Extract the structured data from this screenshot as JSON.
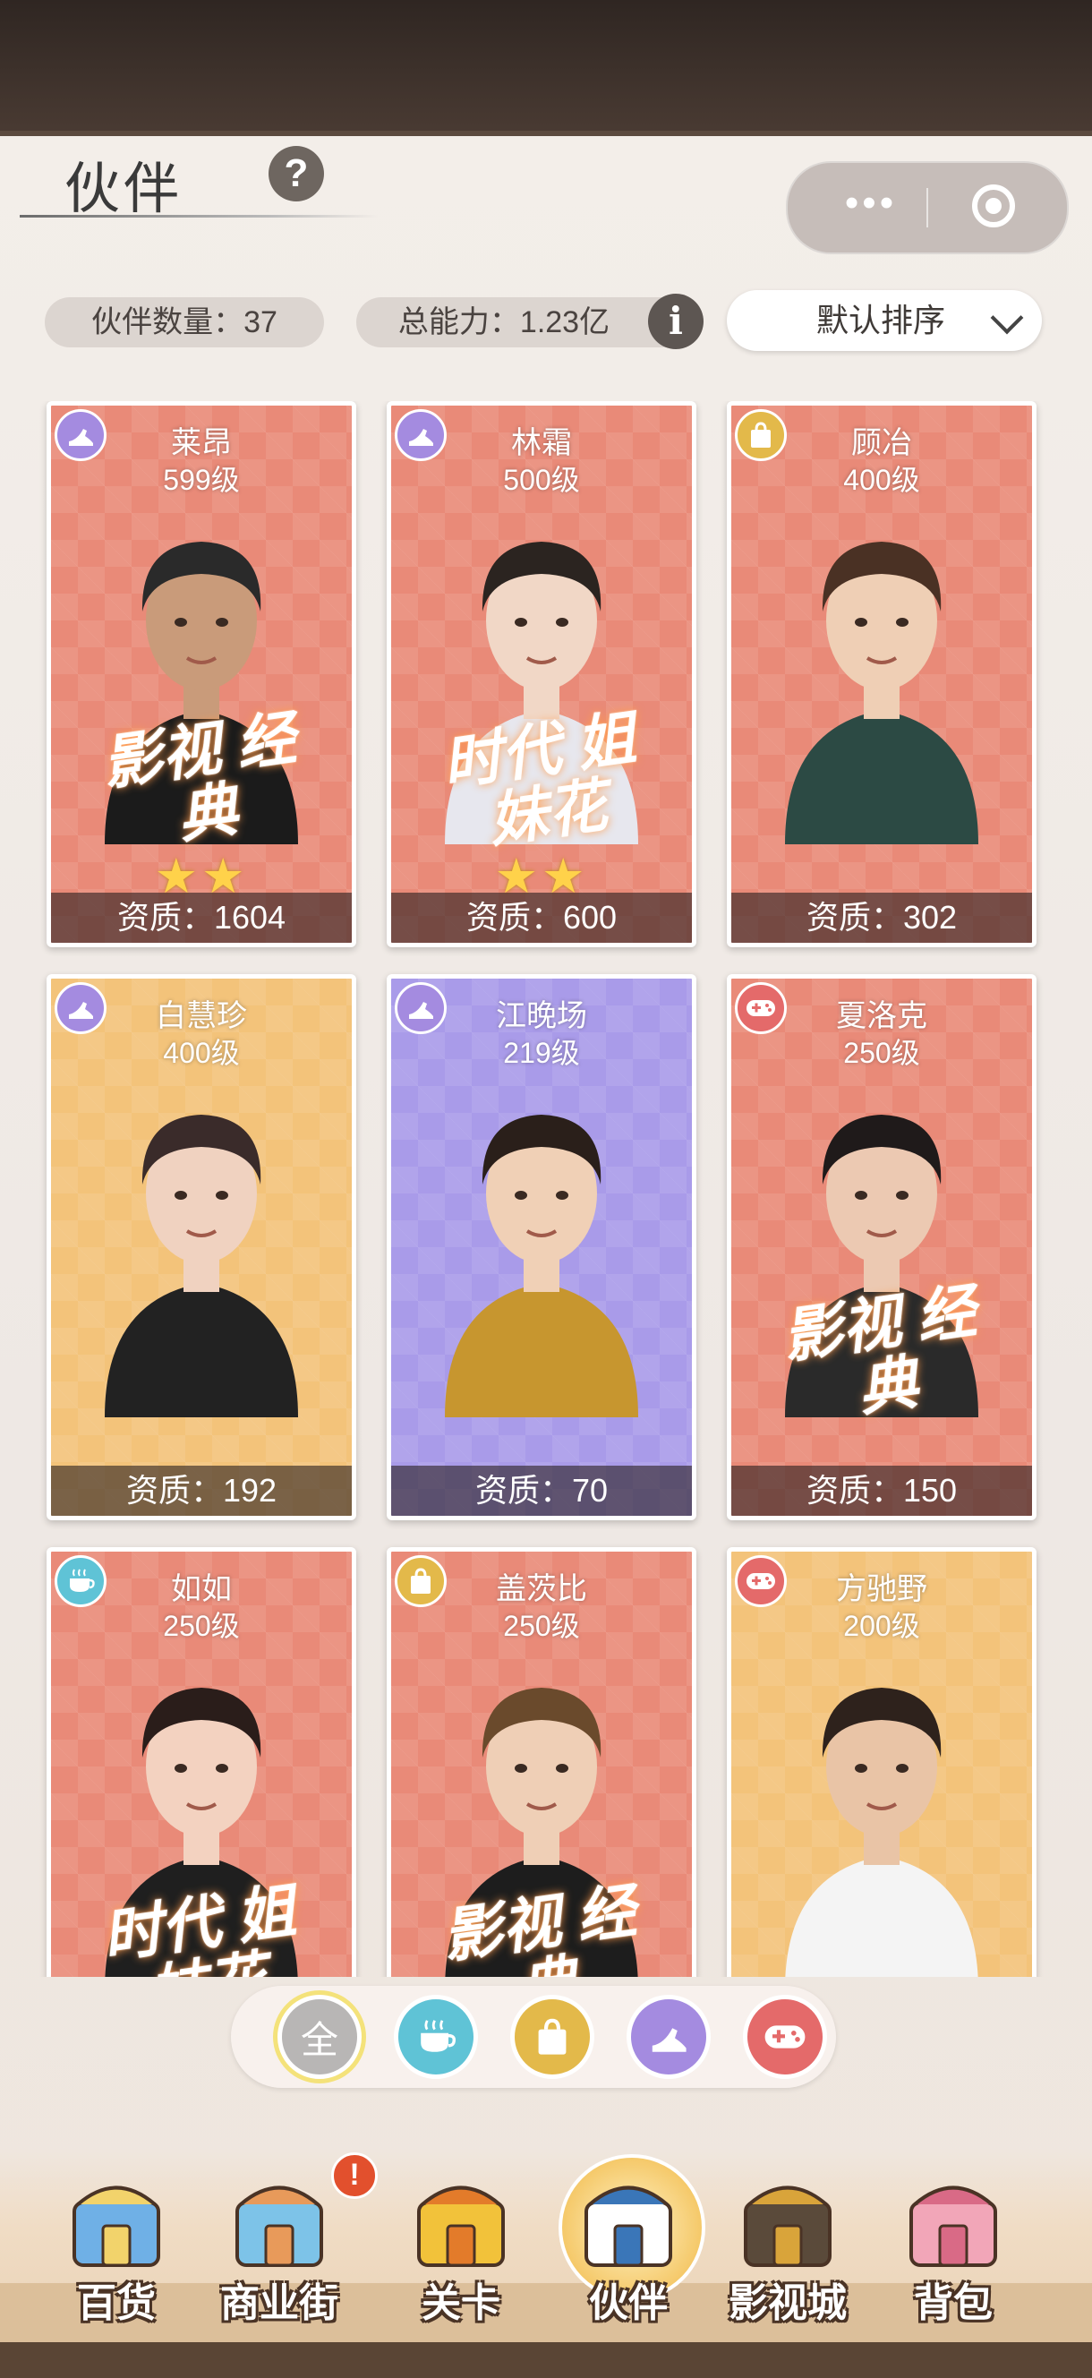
{
  "header": {
    "title": "伙伴",
    "help_icon": "?",
    "capsule_more": "•••"
  },
  "stats": {
    "partner_count": "伙伴数量：37",
    "total_power": "总能力：1.23亿",
    "info_icon": "i"
  },
  "sort": {
    "label": "默认排序"
  },
  "cards": [
    {
      "name": "莱昂",
      "level": "599级",
      "quality": "资质：1604",
      "badge": "影视 经典",
      "stars": "★★",
      "category_icon": "shoe-icon",
      "bg": "#e98a78",
      "category_color": "#a48be0"
    },
    {
      "name": "林霜",
      "level": "500级",
      "quality": "资质：600",
      "badge": "时代 姐妹花",
      "stars": "★★",
      "category_icon": "shoe-icon",
      "bg": "#e98a78",
      "category_color": "#a48be0"
    },
    {
      "name": "顾冶",
      "level": "400级",
      "quality": "资质：302",
      "badge": "",
      "stars": "",
      "category_icon": "bag-icon",
      "bg": "#e98a78",
      "category_color": "#e3b94a"
    },
    {
      "name": "白慧珍",
      "level": "400级",
      "quality": "资质：192",
      "badge": "",
      "stars": "",
      "category_icon": "shoe-icon",
      "bg": "#f3c37a",
      "category_color": "#a48be0"
    },
    {
      "name": "江晚场",
      "level": "219级",
      "quality": "资质：70",
      "badge": "",
      "stars": "",
      "category_icon": "shoe-icon",
      "bg": "#a99be9",
      "category_color": "#a48be0"
    },
    {
      "name": "夏洛克",
      "level": "250级",
      "quality": "资质：150",
      "badge": "影视 经典",
      "stars": "",
      "category_icon": "gamepad-icon",
      "bg": "#e98a78",
      "category_color": "#e46a6a"
    },
    {
      "name": "如如",
      "level": "250级",
      "quality": "",
      "badge": "时代 姐妹花",
      "stars": "",
      "category_icon": "coffee-icon",
      "bg": "#e98a78",
      "category_color": "#5fc3d6"
    },
    {
      "name": "盖茨比",
      "level": "250级",
      "quality": "",
      "badge": "影视 经典",
      "stars": "",
      "category_icon": "bag-icon",
      "bg": "#e98a78",
      "category_color": "#e3b94a"
    },
    {
      "name": "方驰野",
      "level": "200级",
      "quality": "",
      "badge": "",
      "stars": "",
      "category_icon": "gamepad-icon",
      "bg": "#f3c37a",
      "category_color": "#e46a6a"
    }
  ],
  "filters": [
    {
      "label": "全",
      "icon": "all-icon",
      "color": "#b8b6b5"
    },
    {
      "label": "",
      "icon": "coffee-icon",
      "color": "#5fc3d6"
    },
    {
      "label": "",
      "icon": "bag-icon",
      "color": "#e3b94a"
    },
    {
      "label": "",
      "icon": "shoe-icon",
      "color": "#a48be0"
    },
    {
      "label": "",
      "icon": "gamepad-icon",
      "color": "#e46a6a"
    }
  ],
  "nav": {
    "tabs": [
      {
        "label": "百货",
        "icon": "department-store-icon"
      },
      {
        "label": "商业街",
        "icon": "commercial-street-icon"
      },
      {
        "label": "关卡",
        "icon": "truck-icon"
      },
      {
        "label": "伙伴",
        "icon": "partner-icon"
      },
      {
        "label": "影视城",
        "icon": "film-reel-icon"
      },
      {
        "label": "背包",
        "icon": "handbag-icon"
      }
    ],
    "alert": "!"
  }
}
